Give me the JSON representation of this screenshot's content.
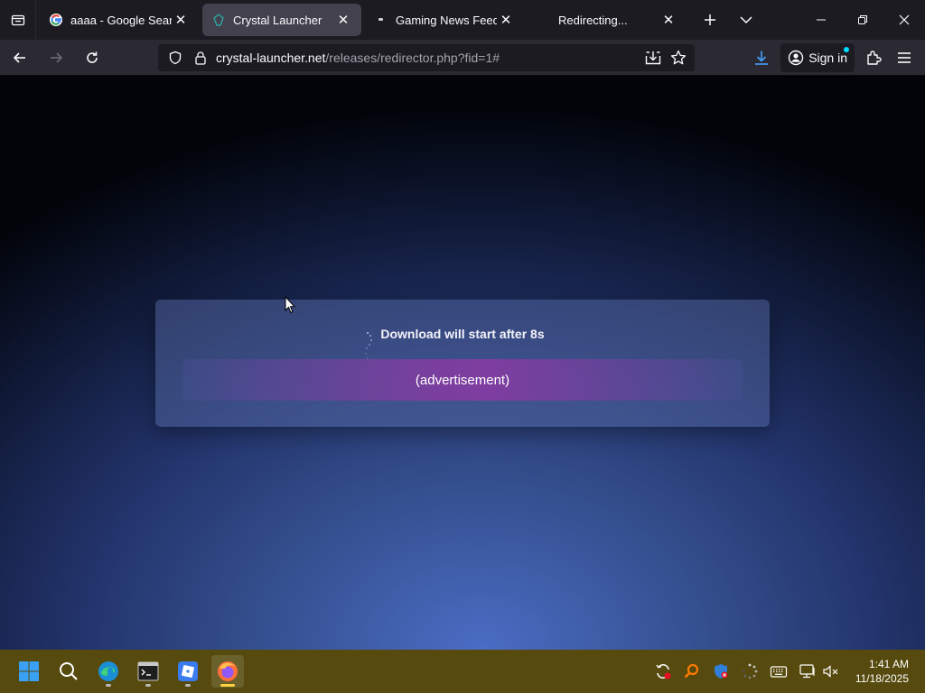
{
  "browser": {
    "tabs": [
      {
        "title": "aaaa - Google Search",
        "active": false,
        "favicon": "google-icon"
      },
      {
        "title": "Crystal Launcher",
        "active": true,
        "favicon": "crystal-launcher-icon"
      },
      {
        "title": "Gaming News Feed",
        "active": false,
        "favicon": "page-dot-icon"
      },
      {
        "title": "Redirecting...",
        "active": false,
        "favicon": "none"
      }
    ],
    "url_host": "crystal-launcher.net",
    "url_path": "/releases/redirector.php?fid=1#",
    "sign_in_label": "Sign in"
  },
  "page": {
    "status_text": "Download will start after 8s",
    "ad_label": "(advertisement)"
  },
  "taskbar": {
    "time": "1:41 AM",
    "date": "11/18/2025",
    "apps": [
      "start-icon",
      "search-icon",
      "edge-icon",
      "terminal-icon",
      "roblox-icon",
      "firefox-icon"
    ],
    "active_app": "firefox-icon"
  },
  "colors": {
    "ad_purple": "#7e3da0",
    "taskbar": "#564a0e",
    "accent": "#00ddff"
  }
}
